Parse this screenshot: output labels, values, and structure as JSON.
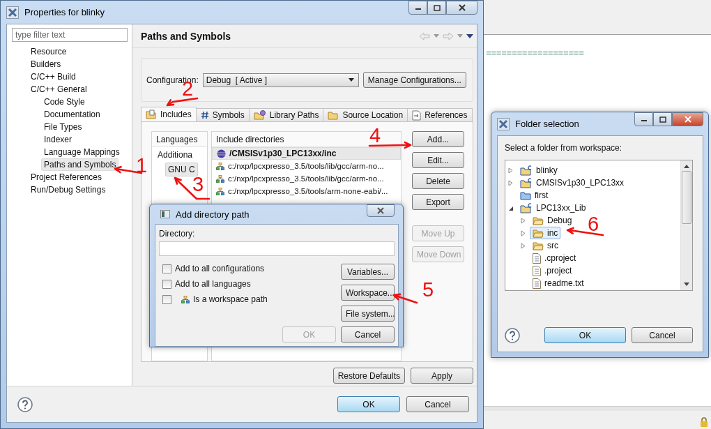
{
  "editor": {
    "lines": [
      "==================="
    ]
  },
  "main_window": {
    "title": "Properties for blinky",
    "filter": {
      "placeholder": "type filter text"
    },
    "nav": [
      {
        "label": "Resource",
        "selected": false
      },
      {
        "label": "Builders",
        "selected": false
      },
      {
        "label": "C/C++ Build",
        "selected": false
      },
      {
        "label": "C/C++ General",
        "selected": false,
        "children": [
          {
            "label": "Code Style",
            "selected": false
          },
          {
            "label": "Documentation",
            "selected": false
          },
          {
            "label": "File Types",
            "selected": false
          },
          {
            "label": "Indexer",
            "selected": false
          },
          {
            "label": "Language Mappings",
            "selected": false
          },
          {
            "label": "Paths and Symbols",
            "selected": true
          }
        ]
      },
      {
        "label": "Project References",
        "selected": false
      },
      {
        "label": "Run/Debug Settings",
        "selected": false
      }
    ],
    "page_title": "Paths and Symbols",
    "configuration": {
      "label": "Configuration:",
      "value": "Debug  [ Active ]",
      "button": "Manage Configurations..."
    },
    "tabs": [
      {
        "label": "Includes",
        "kind": "includes",
        "selected": true
      },
      {
        "label": "Symbols",
        "kind": "symbols",
        "selected": false
      },
      {
        "label": "Library Paths",
        "kind": "libraries",
        "selected": false
      },
      {
        "label": "Source Location",
        "kind": "folder",
        "selected": false
      },
      {
        "label": "References",
        "kind": "references",
        "selected": false
      }
    ],
    "languages": {
      "header": "Languages",
      "items": [
        {
          "label": "Additiona",
          "selected": false
        },
        {
          "label": "GNU C",
          "selected": true
        }
      ]
    },
    "include_directories": {
      "header": "Include directories",
      "rows": [
        {
          "path": "/CMSISv1p30_LPC13xx/inc",
          "kind": "workspace",
          "selected": true
        },
        {
          "path": "c:/nxp/lpcxpresso_3.5/tools/lib/gcc/arm-no...",
          "kind": "filesystem",
          "selected": false
        },
        {
          "path": "c:/nxp/lpcxpresso_3.5/tools/lib/gcc/arm-no...",
          "kind": "filesystem",
          "selected": false
        },
        {
          "path": "c:/nxp/lpcxpresso_3.5/tools/arm-none-eabi/...",
          "kind": "filesystem",
          "selected": false
        }
      ]
    },
    "side_buttons": [
      {
        "label": "Add...",
        "disabled": false
      },
      {
        "label": "Edit...",
        "disabled": false
      },
      {
        "label": "Delete",
        "disabled": false
      },
      {
        "label": "Export",
        "disabled": false
      },
      {
        "label": "Move Up",
        "disabled": true
      },
      {
        "label": "Move Down",
        "disabled": true
      }
    ],
    "restore_defaults": "Restore Defaults",
    "apply": "Apply",
    "ok": "OK",
    "cancel": "Cancel"
  },
  "add_directory_dialog": {
    "title": "Add directory path",
    "directory_label": "Directory:",
    "options": [
      {
        "label": "Add to all configurations",
        "checked": false,
        "kind": "plain"
      },
      {
        "label": "Add to all languages",
        "checked": false,
        "kind": "plain"
      },
      {
        "label": "Is a workspace path",
        "checked": false,
        "kind": "workspace"
      }
    ],
    "buttons": [
      {
        "label": "Variables...",
        "disabled": false
      },
      {
        "label": "Workspace...",
        "disabled": false
      },
      {
        "label": "File system...",
        "disabled": false
      }
    ],
    "ok": {
      "label": "OK",
      "disabled": true
    },
    "cancel": "Cancel"
  },
  "folder_dialog": {
    "title": "Folder selection",
    "prompt": "Select a folder from workspace:",
    "tree": [
      {
        "label": "blinky",
        "kind": "project",
        "expandable": true,
        "expanded": false,
        "selected": false
      },
      {
        "label": "CMSISv1p30_LPC13xx",
        "kind": "project",
        "expandable": true,
        "expanded": false,
        "selected": false
      },
      {
        "label": "first",
        "kind": "closed_project",
        "expandable": false,
        "selected": false
      },
      {
        "label": "LPC13xx_Lib",
        "kind": "project",
        "expandable": true,
        "expanded": true,
        "selected": false,
        "children": [
          {
            "label": "Debug",
            "kind": "folder",
            "expandable": true,
            "expanded": false,
            "selected": false
          },
          {
            "label": "inc",
            "kind": "folder",
            "expandable": true,
            "expanded": false,
            "selected": true
          },
          {
            "label": "src",
            "kind": "folder",
            "expandable": true,
            "expanded": false,
            "selected": false
          },
          {
            "label": ".cproject",
            "kind": "file",
            "expandable": false,
            "selected": false
          },
          {
            "label": ".project",
            "kind": "file",
            "expandable": false,
            "selected": false
          },
          {
            "label": "readme.txt",
            "kind": "file",
            "expandable": false,
            "selected": false
          }
        ]
      }
    ],
    "ok": "OK",
    "cancel": "Cancel"
  },
  "annotations": [
    {
      "label": "1"
    },
    {
      "label": "2"
    },
    {
      "label": "3"
    },
    {
      "label": "4"
    },
    {
      "label": "5"
    },
    {
      "label": "6"
    }
  ]
}
